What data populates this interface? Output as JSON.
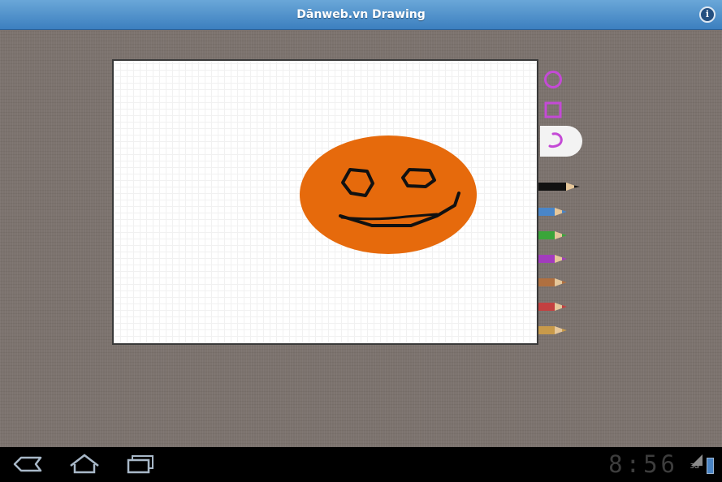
{
  "app": {
    "title": "Dānweb.vn Drawing"
  },
  "header": {
    "info_label": "i"
  },
  "tools": {
    "shapes": [
      "circle-tool",
      "rectangle-tool",
      "freehand-tool"
    ],
    "shape_color": "#c44ad6",
    "pencils": [
      {
        "name": "black-pencil",
        "color": "#111111"
      },
      {
        "name": "blue-pencil",
        "color": "#4a86c8"
      },
      {
        "name": "green-pencil",
        "color": "#3aa53a"
      },
      {
        "name": "purple-pencil",
        "color": "#a23cbe"
      },
      {
        "name": "brown-pencil",
        "color": "#b07040"
      },
      {
        "name": "red-pencil",
        "color": "#c34040"
      },
      {
        "name": "tan-pencil",
        "color": "#c89a4a"
      }
    ]
  },
  "drawing": {
    "fill_color": "#e66a0c",
    "stroke_color": "#111111"
  },
  "statusbar": {
    "time": "8:56",
    "network": "3G"
  }
}
